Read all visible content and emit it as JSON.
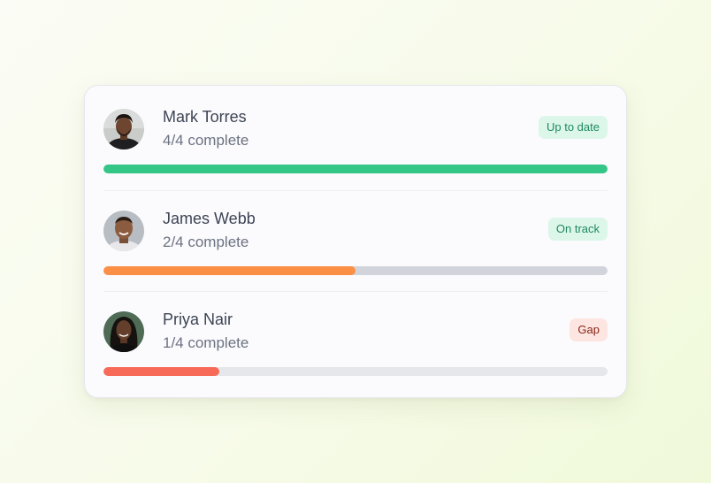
{
  "members": [
    {
      "name": "Mark Torres",
      "progress_text": "4/4 complete",
      "status": "Up to date",
      "progress": 1.0,
      "bar_color": "#34c687",
      "avatar": "person-photo"
    },
    {
      "name": "James Webb",
      "progress_text": "2/4 complete",
      "status": "On track",
      "progress": 0.5,
      "bar_color": "#fb8f45",
      "avatar": "person-photo"
    },
    {
      "name": "Priya Nair",
      "progress_text": "1/4 complete",
      "status": "Gap",
      "progress": 0.25,
      "bar_color": "#f76a58",
      "avatar": "person-photo"
    }
  ],
  "colors": {
    "success_badge_bg": "#dcf6ea",
    "success_badge_text": "#1f8a5e",
    "gap_badge_bg": "#fde6e1",
    "gap_badge_text": "#8a2418",
    "track": "#d1d5db"
  }
}
